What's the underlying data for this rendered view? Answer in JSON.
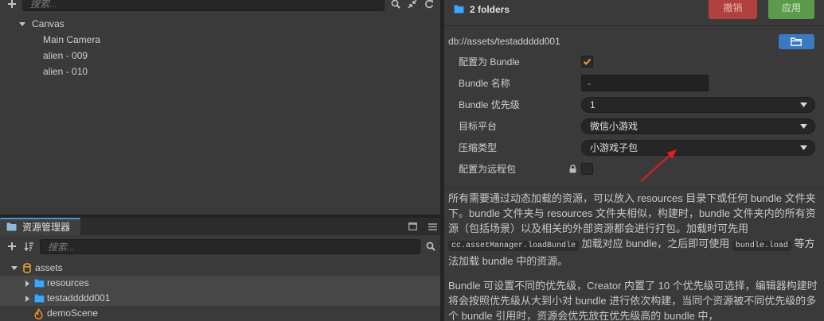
{
  "hierarchy": {
    "search_placeholder": "搜索...",
    "nodes": [
      {
        "label": "Canvas",
        "expanded": true
      },
      {
        "label": "Main Camera"
      },
      {
        "label": "alien - 009"
      },
      {
        "label": "alien - 010"
      }
    ],
    "toolbar_icons": [
      "add-icon",
      "search-icon",
      "collapse-icon",
      "refresh-icon"
    ]
  },
  "assets_panel": {
    "tab_label": "资源管理器",
    "search_placeholder": "搜索...",
    "tab_icons": [
      "maximize-icon",
      "menu-icon"
    ],
    "items": [
      {
        "label": "assets",
        "icon": "database-icon",
        "expanded": true
      },
      {
        "label": "resources",
        "icon": "folder-icon",
        "selected": true
      },
      {
        "label": "testaddddd001",
        "icon": "folder-icon",
        "selected": true
      },
      {
        "label": "demoScene",
        "icon": "scene-flame-icon"
      }
    ]
  },
  "inspector": {
    "title": "2 folders",
    "revert_label": "撤销",
    "apply_label": "应用",
    "path": "db://assets/testaddddd001",
    "properties": {
      "is_bundle": {
        "label": "配置为 Bundle",
        "checked": true
      },
      "bundle_name": {
        "label": "Bundle 名称",
        "value": "-"
      },
      "priority": {
        "label": "Bundle 优先级",
        "value": "1"
      },
      "target_platform": {
        "label": "目标平台",
        "value": "微信小游戏"
      },
      "compression": {
        "label": "压缩类型",
        "value": "小游戏子包"
      },
      "remote": {
        "label": "配置为远程包",
        "checked": false,
        "locked": true
      }
    },
    "help": {
      "paragraph1": [
        {
          "text": "所有需要通过动态加载的资源，可以放入 resources 目录下或任何 bundle 文件夹下。bundle 文件夹与 resources 文件夹相似，构建时，bundle 文件夹内的所有资源（包括场景）以及相关的外部资源都会进行打包。加载时可先用 "
        },
        {
          "code": "cc.assetManager.loadBundle"
        },
        {
          "text": " 加载对应 bundle，之后即可使用 "
        },
        {
          "code": "bundle.load"
        },
        {
          "text": " 等方法加载 bundle 中的资源。"
        }
      ],
      "paragraph2": "Bundle 可设置不同的优先级，Creator 内置了 10 个优先级可选择，编辑器构建时将会按照优先级从大到小对 bundle 进行依次构建，当同个资源被不同优先级的多个 bundle 引用时，资源会优先放在优先级高的 bundle 中，"
    }
  },
  "colors": {
    "panel_bg": "#3a3a3a",
    "input_bg": "#262626",
    "accent_orange": "#f0a030",
    "revert_button": "#b0413e",
    "apply_button": "#5c9b4b",
    "folder_button": "#3b7ac2",
    "folder_icon": "#42a5f5",
    "selected_row": "#474747",
    "annotation_arrow": "#e31e1e"
  }
}
